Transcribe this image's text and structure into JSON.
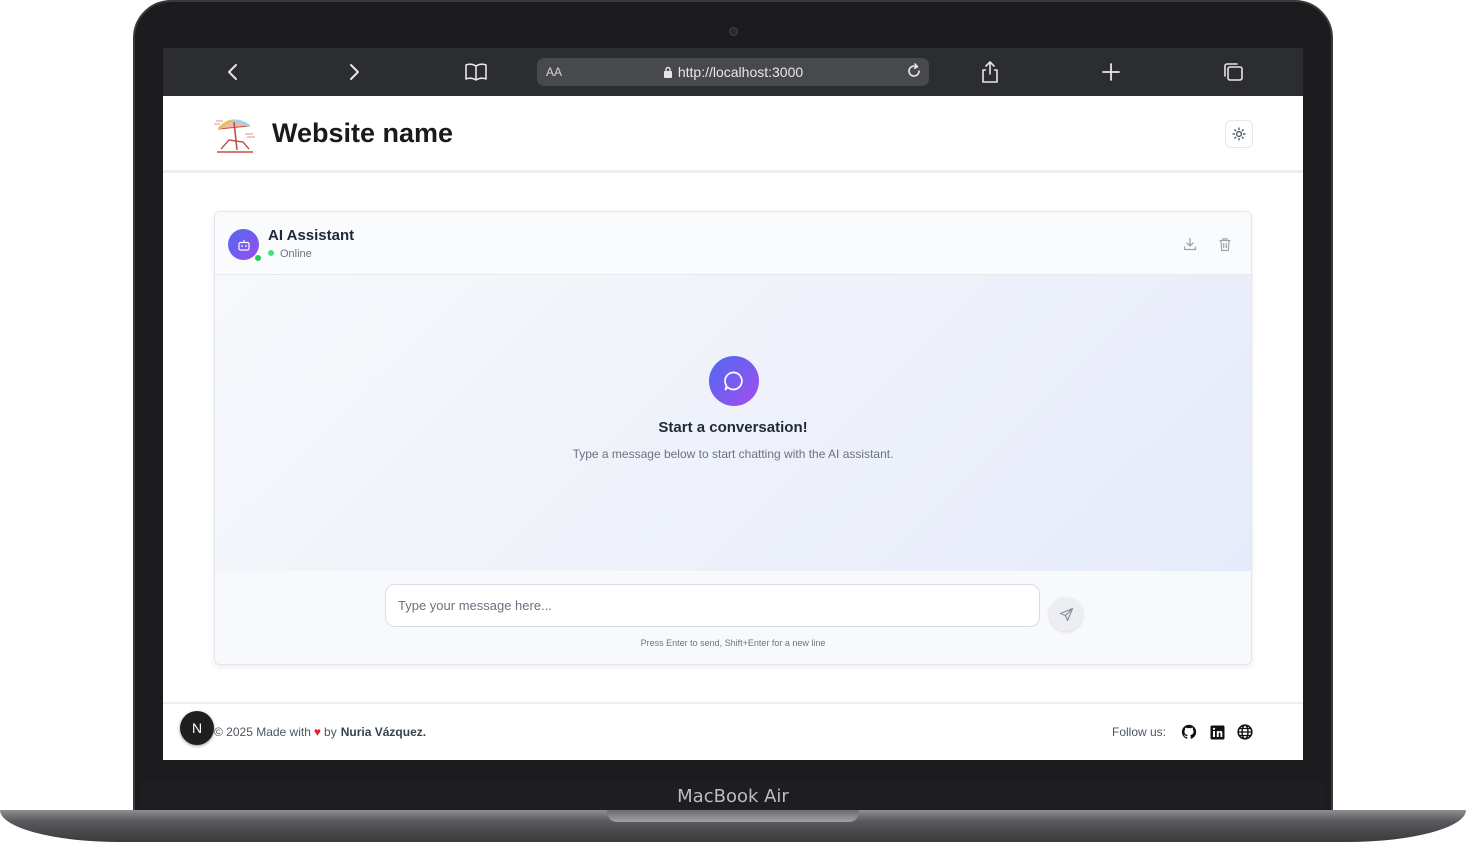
{
  "device": {
    "brand_label": "MacBook Air"
  },
  "browser": {
    "reader_label": "AA",
    "url": "http://localhost:3000",
    "icons": {
      "back": "chevron-left-icon",
      "forward": "chevron-right-icon",
      "bookmarks": "book-icon",
      "lock": "lock-icon",
      "reload": "reload-icon",
      "share": "share-icon",
      "new_tab": "plus-icon",
      "tabs": "tabs-icon"
    }
  },
  "header": {
    "title": "Website name",
    "logo_icon": "beach-umbrella-icon",
    "theme_toggle_icon": "sun-icon"
  },
  "chat": {
    "assistant_name": "AI Assistant",
    "status": "Online",
    "status_color": "#22c55e",
    "download_icon": "download-icon",
    "delete_icon": "trash-icon",
    "empty_state": {
      "icon": "chat-bubble-icon",
      "title": "Start a conversation!",
      "subtitle": "Type a message below to start chatting with the AI assistant."
    },
    "input": {
      "placeholder": "Type your message here...",
      "value": ""
    },
    "send_icon": "send-icon",
    "hint": "Press Enter to send, Shift+Enter for a new line",
    "accent_from": "#4f6bf0",
    "accent_to": "#a24cf0"
  },
  "footer": {
    "badge": "N",
    "copyright_prefix": "© 2025 Made with",
    "copyright_by": "by",
    "author": "Nuria Vázquez.",
    "follow_label": "Follow us:",
    "socials": [
      "github-icon",
      "linkedin-icon",
      "globe-icon"
    ]
  }
}
